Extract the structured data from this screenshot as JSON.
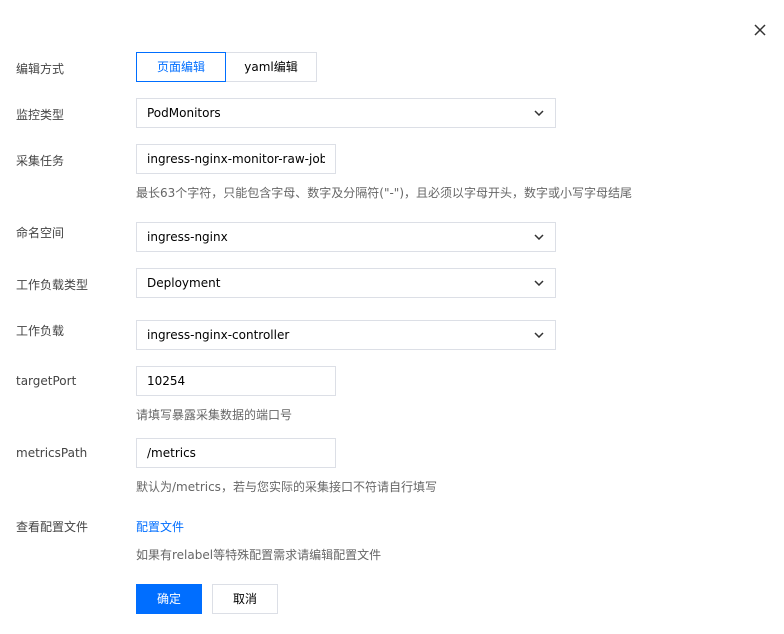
{
  "form": {
    "edit_mode": {
      "label": "编辑方式",
      "options": [
        "页面编辑",
        "yaml编辑"
      ],
      "selected": "页面编辑"
    },
    "monitor_type": {
      "label": "监控类型",
      "value": "PodMonitors"
    },
    "collect_job": {
      "label": "采集任务",
      "value": "ingress-nginx-monitor-raw-job",
      "hint": "最长63个字符，只能包含字母、数字及分隔符(\"-\")，且必须以字母开头，数字或小写字母结尾"
    },
    "namespace": {
      "label": "命名空间",
      "value": "ingress-nginx"
    },
    "workload_type": {
      "label": "工作负载类型",
      "value": "Deployment"
    },
    "workload": {
      "label": "工作负载",
      "value": "ingress-nginx-controller"
    },
    "target_port": {
      "label": "targetPort",
      "value": "10254",
      "hint": "请填写暴露采集数据的端口号"
    },
    "metrics_path": {
      "label": "metricsPath",
      "value": "/metrics",
      "hint": "默认为/metrics，若与您实际的采集接口不符请自行填写"
    },
    "config_file": {
      "label": "查看配置文件",
      "link": "配置文件",
      "hint": "如果有relabel等特殊配置需求请编辑配置文件"
    }
  },
  "actions": {
    "confirm": "确定",
    "cancel": "取消"
  },
  "icons": {
    "close": "close-icon",
    "dropdown": "chevron-down-icon"
  },
  "colors": {
    "primary": "#006eff",
    "border": "#dcdfe6",
    "hint": "#666666"
  }
}
